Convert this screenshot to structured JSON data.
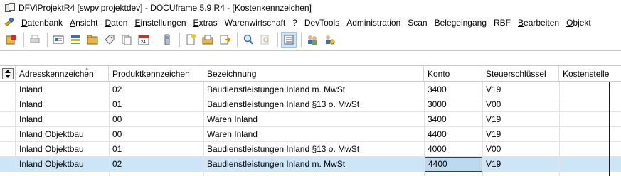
{
  "window": {
    "title": "DFViProjektR4 [swpviprojektdev] - DOCUframe 5.9 R4 - [Kostenkennzeichen]"
  },
  "menu": {
    "items": [
      {
        "label": "Datenbank"
      },
      {
        "label": "Ansicht"
      },
      {
        "label": "Daten"
      },
      {
        "label": "Einstellungen"
      },
      {
        "label": "Extras"
      },
      {
        "label": "Warenwirtschaft"
      },
      {
        "label": "?"
      },
      {
        "label": "DevTools"
      },
      {
        "label": "Administration"
      },
      {
        "label": "Scan"
      },
      {
        "label": "Belegeingang"
      },
      {
        "label": "RBF"
      },
      {
        "label": "Bearbeiten"
      },
      {
        "label": "Objekt"
      }
    ]
  },
  "toolbar": {
    "buttons": [
      {
        "icon": "new-record-icon"
      },
      {
        "icon": "print-icon"
      },
      {
        "icon": "address-card-icon"
      },
      {
        "icon": "list-icon"
      },
      {
        "icon": "folder-icon"
      },
      {
        "icon": "tag-icon"
      },
      {
        "icon": "copy-icon"
      },
      {
        "icon": "calendar-icon"
      },
      {
        "icon": "phone-icon"
      },
      {
        "icon": "new-document-icon"
      },
      {
        "icon": "open-document-icon"
      },
      {
        "icon": "export-icon"
      },
      {
        "icon": "search-icon"
      },
      {
        "icon": "search-disabled-icon"
      },
      {
        "icon": "form-view-icon"
      },
      {
        "icon": "users-icon"
      },
      {
        "icon": "user-settings-icon"
      }
    ]
  },
  "table": {
    "columns": [
      {
        "label": "Adresskennzeichen"
      },
      {
        "label": "Produktkennzeichen"
      },
      {
        "label": "Bezeichnung"
      },
      {
        "label": "Konto"
      },
      {
        "label": "Steuerschlüssel"
      },
      {
        "label": "Kostenstelle"
      }
    ],
    "rows": [
      {
        "adress": "Inland",
        "produkt": "02",
        "bezeichnung": "Baudienstleistungen Inland m. MwSt",
        "konto": "3400",
        "steuer": "V19",
        "kostenstelle": ""
      },
      {
        "adress": "Inland",
        "produkt": "01",
        "bezeichnung": "Baudienstleistungen Inland §13 o. MwSt",
        "konto": "3000",
        "steuer": "V00",
        "kostenstelle": ""
      },
      {
        "adress": "Inland",
        "produkt": "00",
        "bezeichnung": "Waren Inland",
        "konto": "3400",
        "steuer": "V19",
        "kostenstelle": ""
      },
      {
        "adress": "Inland Objektbau",
        "produkt": "00",
        "bezeichnung": "Waren Inland",
        "konto": "4400",
        "steuer": "V19",
        "kostenstelle": ""
      },
      {
        "adress": "Inland Objektbau",
        "produkt": "01",
        "bezeichnung": "Baudienstleistungen Inland §13 o. MwSt",
        "konto": "4000",
        "steuer": "V00",
        "kostenstelle": ""
      },
      {
        "adress": "Inland Objektbau",
        "produkt": "02",
        "bezeichnung": "Baudienstleistungen Inland m. MwSt",
        "konto": "4400",
        "steuer": "V19",
        "kostenstelle": ""
      }
    ],
    "selected_row": 6,
    "focused_cell": "Konto"
  }
}
